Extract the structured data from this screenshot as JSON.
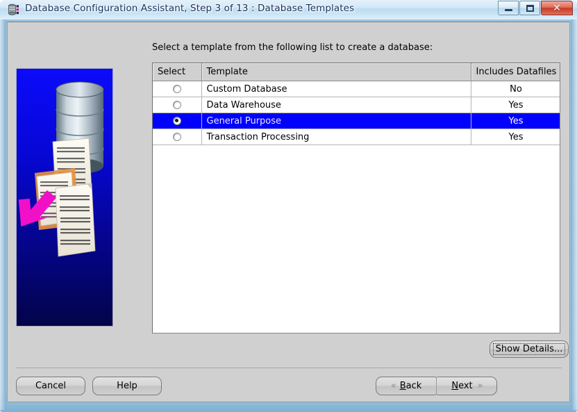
{
  "window": {
    "title": "Database Configuration Assistant, Step 3 of 13 : Database Templates",
    "icon": "database-icon",
    "controls": {
      "minimize": "minimize-icon",
      "maximize": "maximize-icon",
      "close": "✕"
    }
  },
  "main": {
    "instruction": "Select a template from the following list to create a database:",
    "sidebar_image_alt": "database-illustration"
  },
  "table": {
    "columns": [
      "Select",
      "Template",
      "Includes Datafiles"
    ],
    "rows": [
      {
        "selected": false,
        "template": "Custom Database",
        "datafiles": "No"
      },
      {
        "selected": false,
        "template": "Data Warehouse",
        "datafiles": "Yes"
      },
      {
        "selected": true,
        "template": "General Purpose",
        "datafiles": "Yes"
      },
      {
        "selected": false,
        "template": "Transaction Processing",
        "datafiles": "Yes"
      }
    ]
  },
  "buttons": {
    "show_details": "Show Details...",
    "cancel": "Cancel",
    "help": "Help",
    "back": "Back",
    "back_mnemonic": "B",
    "back_rest": "ack",
    "next": "Next",
    "next_mnemonic": "N",
    "next_rest": "ext",
    "chevron_left": "«",
    "chevron_right": "»"
  },
  "colors": {
    "selection": "#0000ff",
    "frame": "#9ec5e0",
    "panel": "#d0d0d0",
    "close_button": "#c73a22"
  }
}
